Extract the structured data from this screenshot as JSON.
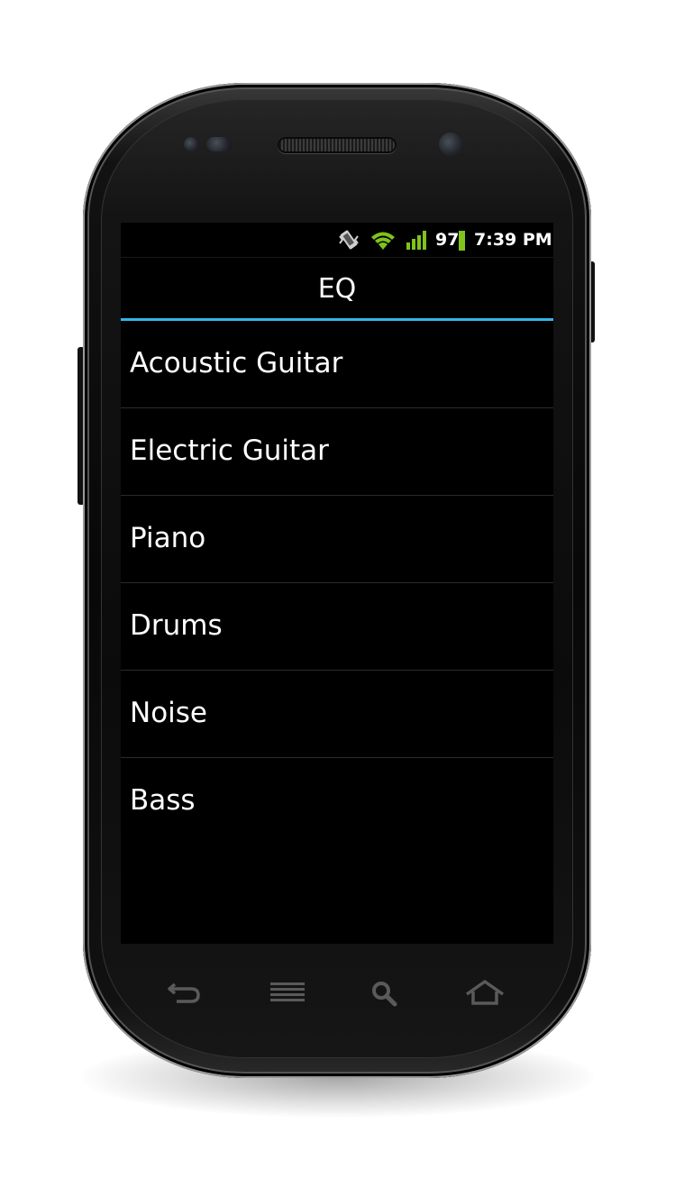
{
  "status_bar": {
    "battery_level": "97",
    "time": "7:39 PM",
    "icons": [
      "vibrate-icon",
      "wifi-icon",
      "signal-icon",
      "battery-icon"
    ]
  },
  "title_bar": {
    "title": "EQ"
  },
  "list": {
    "items": [
      {
        "label": "Acoustic Guitar"
      },
      {
        "label": "Electric Guitar"
      },
      {
        "label": "Piano"
      },
      {
        "label": "Drums"
      },
      {
        "label": "Noise"
      },
      {
        "label": "Bass"
      }
    ]
  },
  "nav_bar": {
    "buttons": [
      "back-icon",
      "menu-icon",
      "search-icon",
      "home-icon"
    ]
  },
  "colors": {
    "accent": "#33b5e5",
    "signal": "#7fc31c",
    "background": "#000000",
    "text": "#ffffff"
  }
}
